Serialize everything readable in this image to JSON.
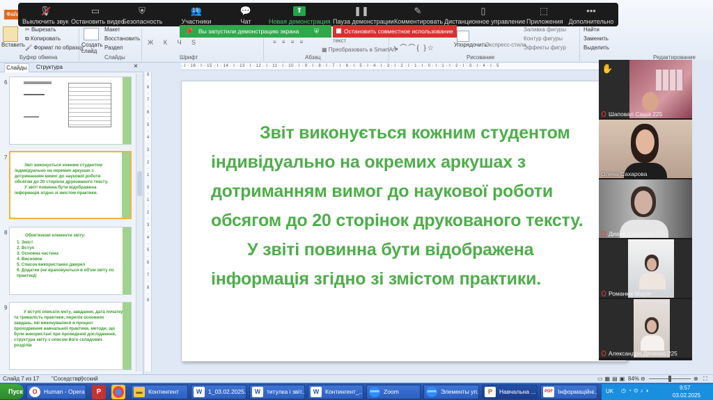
{
  "ribbon": {
    "file_tab": "Файл",
    "paste": "Вставить",
    "cut": "Вырезать",
    "copy": "Копировать",
    "format_painter": "Формат по образцу",
    "clipboard_group": "Буфер обмена",
    "new_slide": "Создать слайд",
    "layout": "Макет",
    "reset": "Восстановить",
    "section": "Раздел",
    "slides_group": "Слайды",
    "font_group": "Шрифт",
    "paragraph_group": "Абзац",
    "convert_smartart": "Преобразовать в SmartArt",
    "drawing_group": "Рисование",
    "arrange": "Упорядочить",
    "quick_styles": "Экспресс-стили",
    "shape_fill": "Заливка фигуры",
    "shape_outline": "Контур фигуры",
    "shape_effects": "Эффекты фигур",
    "find": "Найти",
    "replace": "Заменить",
    "select": "Выделить",
    "editing_group": "Редактирование",
    "text_partial": "текст"
  },
  "zoom_toolbar": {
    "buttons": [
      "Выключить звук",
      "Остановить видео",
      "Безопасность",
      "Участники",
      "Чат",
      "Новая демонстрация",
      "Пауза демонстрации",
      "Комментировать",
      "Дистанционное управление",
      "Приложения",
      "Дополнительно"
    ],
    "participants_count": "19",
    "share_banner": "Вы запустили демонстрацию экрана",
    "stop_share": "Остановить совместное использование"
  },
  "left_pane": {
    "tab_slides": "Слайды",
    "tab_structure": "Структура",
    "slide_numbers": [
      "6",
      "7",
      "8",
      "9"
    ],
    "thumb7_lines": [
      "Звіт виконується кожним студентом",
      "індивідуально на окремих аркушах з",
      "дотриманням вимог до наукової роботи",
      "обсягом до 20 сторінок друкованого тексту.",
      "У звіті повинна бути відображена",
      "інформація згідно зі змістом практики."
    ],
    "thumb8_title": "Обов'язкові елементи звіту:",
    "thumb8_items": [
      "1.   Зміст",
      "2.   Вступ",
      "3.   Основна частина",
      "4.   Висновок",
      "5.   Список використаних джерел",
      "6.   Додатки (не враховуються в об'єм звіту по",
      "      практиці)"
    ],
    "thumb9_lines": [
      "У вступі описати мету, завдання, дата початку",
      "та тривалість практики; перелік основних",
      "завдань, які виконувалися в процесі",
      "проходження навчальної практики, методи, що",
      "були використані при проведенні дослідження;",
      "структура звіту з описом його складових",
      "розділів"
    ]
  },
  "slide": {
    "lines": [
      "Звіт виконується кожним студентом",
      "індивідуально на окремих аркушах з",
      "дотриманням вимог до наукової роботи",
      "обсягом до 20 сторінок друкованого тексту.",
      "У звіті повинна бути відображена",
      "інформація згідно зі  змістом практики."
    ],
    "text_color": "#4eae4a"
  },
  "participants": [
    {
      "name": "Шаповал Саша 225",
      "muted": true,
      "hand": true
    },
    {
      "name": "Олена Сахарова",
      "muted": false
    },
    {
      "name": "Диана Савицкая 225",
      "muted": true
    },
    {
      "name": "Романюк Марія",
      "muted": true
    },
    {
      "name": "Александра Дяченко 225",
      "muted": true
    }
  ],
  "status": {
    "slide_of": "Слайд 7 из 17",
    "theme": "\"Соседство\"",
    "language": "русский",
    "zoom": "84%"
  },
  "taskbar": {
    "start": "Пуск",
    "items": [
      "Human - Opera",
      "Контингент",
      "1_03.02.2025...",
      "титулка і звіт...",
      "Контингент_...",
      "Zoom",
      "Элементы уп...",
      "Навчальна ...",
      "Інформаційні..."
    ],
    "lang": "UK",
    "time": "9:57",
    "date": "03.02.2025"
  }
}
